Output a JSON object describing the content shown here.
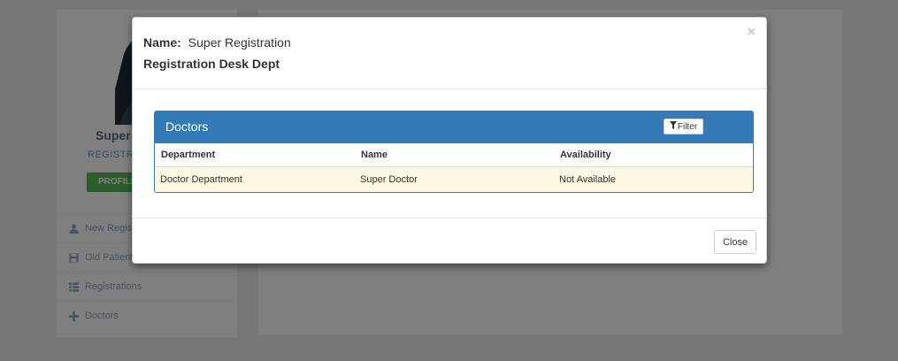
{
  "background": {
    "profile": {
      "name": "Super",
      "role": "REGISTRA",
      "button_label": "PROFILE"
    },
    "menu": [
      {
        "label": "New Regis",
        "icon": "user-icon"
      },
      {
        "label": "Old Patient",
        "icon": "save-icon"
      },
      {
        "label": "Registrations",
        "icon": "list-icon"
      },
      {
        "label": "Doctors",
        "icon": "plus-icon"
      }
    ]
  },
  "modal": {
    "close_symbol": "×",
    "name_label": "Name:",
    "name_value": "Super Registration",
    "department": "Registration Desk Dept",
    "panel": {
      "title": "Doctors",
      "filter_label": "Filter",
      "columns": [
        "Department",
        "Name",
        "Availability"
      ],
      "rows": [
        [
          "Doctor Department",
          "Super Doctor",
          "Not Available"
        ]
      ]
    },
    "footer": {
      "close_label": "Close"
    }
  },
  "colors": {
    "panel_primary": "#337ab7",
    "row_highlight": "#fcf8e3",
    "profile_button": "#5cb85c",
    "role_text": "#5b9bd1"
  }
}
